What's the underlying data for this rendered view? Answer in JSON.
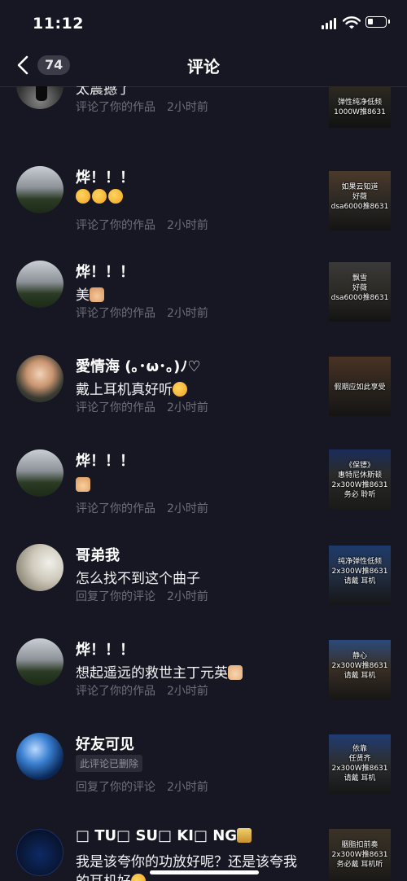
{
  "status_bar": {
    "time": "11:12"
  },
  "nav": {
    "count": "74",
    "title": "评论"
  },
  "comments": [
    {
      "text": "太震撼了",
      "action": "评论了你的作品",
      "ago": "2小时前",
      "thumb_caption": "弹性纯净低频\n1000W推8631"
    },
    {
      "name": "烨！！！",
      "text": "",
      "action": "评论了你的作品",
      "ago": "2小时前",
      "thumb_caption": "如果云知道\n好薇\ndsa6000推8631"
    },
    {
      "name": "烨！！！",
      "text": "美",
      "action": "评论了你的作品",
      "ago": "2小时前",
      "thumb_caption": "飘雪\n好薇\ndsa6000推8631"
    },
    {
      "name": "愛情海 (｡･ω･｡)ﾉ♡",
      "text": "戴上耳机真好听",
      "action": "评论了你的作品",
      "ago": "2小时前",
      "thumb_caption": "假期应如此享受"
    },
    {
      "name": "烨！！！",
      "text": "",
      "action": "评论了你的作品",
      "ago": "2小时前",
      "thumb_caption": "《保镖》\n惠特尼休斯顿\n2x300W推8631\n务必   聆听"
    },
    {
      "name": "哥弟我",
      "text": "怎么找不到这个曲子",
      "action": "回复了你的评论",
      "ago": "2小时前",
      "thumb_caption": "纯净弹性低频\n2x300W推8631\n请戴   耳机"
    },
    {
      "name": "烨！！！",
      "text": "想起遥远的救世主丁元英",
      "action": "评论了你的作品",
      "ago": "2小时前",
      "thumb_caption": "静心\n2x300W推8631\n请戴   耳机"
    },
    {
      "name": "好友可见",
      "deleted_label": "此评论已删除",
      "action": "回复了你的评论",
      "ago": "2小时前",
      "thumb_caption": "依靠\n任贤齐\n2x300W推8631\n请戴   耳机"
    },
    {
      "name": "□ TU□ SU□ KI□ NG",
      "text": "我是该夸你的功放好呢？还是该夸我",
      "text2": "的耳机好",
      "thumb_caption": "胭脂扣前奏\n2x300W推8631\n务必戴   耳机听"
    }
  ]
}
